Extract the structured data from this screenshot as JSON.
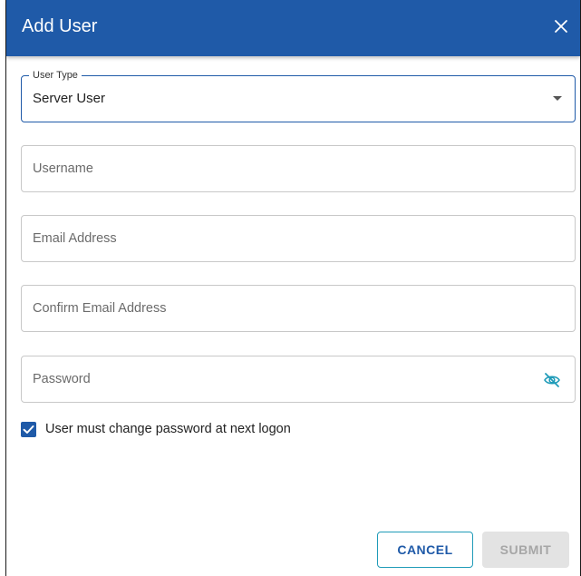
{
  "dialog": {
    "title": "Add User",
    "close_icon": "close-icon"
  },
  "form": {
    "user_type": {
      "label": "User Type",
      "value": "Server User"
    },
    "username": {
      "placeholder": "Username",
      "value": ""
    },
    "email": {
      "placeholder": "Email Address",
      "value": ""
    },
    "confirm_email": {
      "placeholder": "Confirm Email Address",
      "value": ""
    },
    "password": {
      "placeholder": "Password",
      "value": "",
      "toggle_icon": "eye-off-icon"
    },
    "must_change_password": {
      "label": "User must change password at next logon",
      "checked": true
    }
  },
  "actions": {
    "cancel_label": "CANCEL",
    "submit_label": "SUBMIT",
    "submit_disabled": true
  },
  "colors": {
    "header_bg": "#1f5aa8",
    "accent": "#1f5aa8",
    "cancel_border": "#1f9bb8",
    "disabled_bg": "#e3e3e3",
    "disabled_text": "#a6a6a6"
  }
}
